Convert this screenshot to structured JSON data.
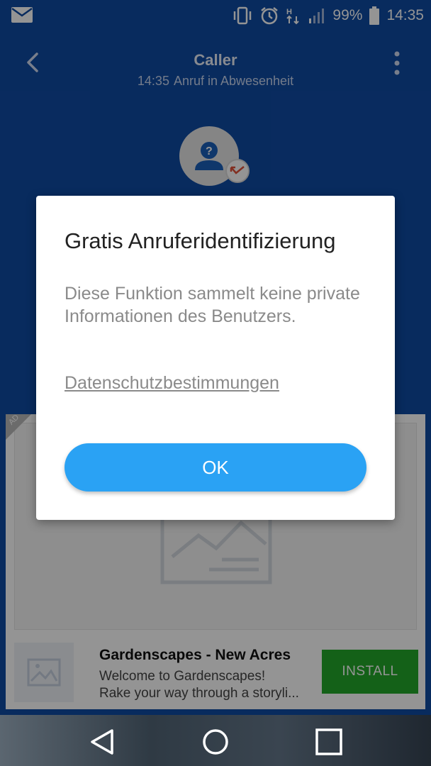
{
  "status_bar": {
    "battery": "99%",
    "time": "14:35",
    "icons": [
      "mail-icon",
      "vibrate-icon",
      "alarm-icon",
      "data-icon",
      "signal-icon",
      "battery-icon"
    ]
  },
  "toolbar": {
    "title": "Caller",
    "call_time": "14:35",
    "call_status": "Anruf in Abwesenheit",
    "icons": [
      "back-arrow-icon",
      "more-vert-icon"
    ]
  },
  "caller": {
    "icons": [
      "unknown-person-icon",
      "missed-call-icon"
    ]
  },
  "ad": {
    "badge": "AD",
    "app_name": "Gardenscapes - New Acres",
    "description_line1": "Welcome to Gardenscapes!",
    "description_line2": "Rake your way through a storyli...",
    "install_label": "INSTALL",
    "install_color": "#23a82a"
  },
  "dialog": {
    "title": "Gratis Anruferidentifizierung",
    "body": "Diese Funktion sammelt keine private Informationen des Benutzers.",
    "link": "Datenschutzbestimmungen",
    "ok_label": "OK",
    "ok_color": "#2aa2f4"
  },
  "nav_bar": {
    "icons": [
      "nav-back-icon",
      "nav-home-icon",
      "nav-recents-icon"
    ]
  },
  "colors": {
    "app_background": "#0f4aa3"
  }
}
